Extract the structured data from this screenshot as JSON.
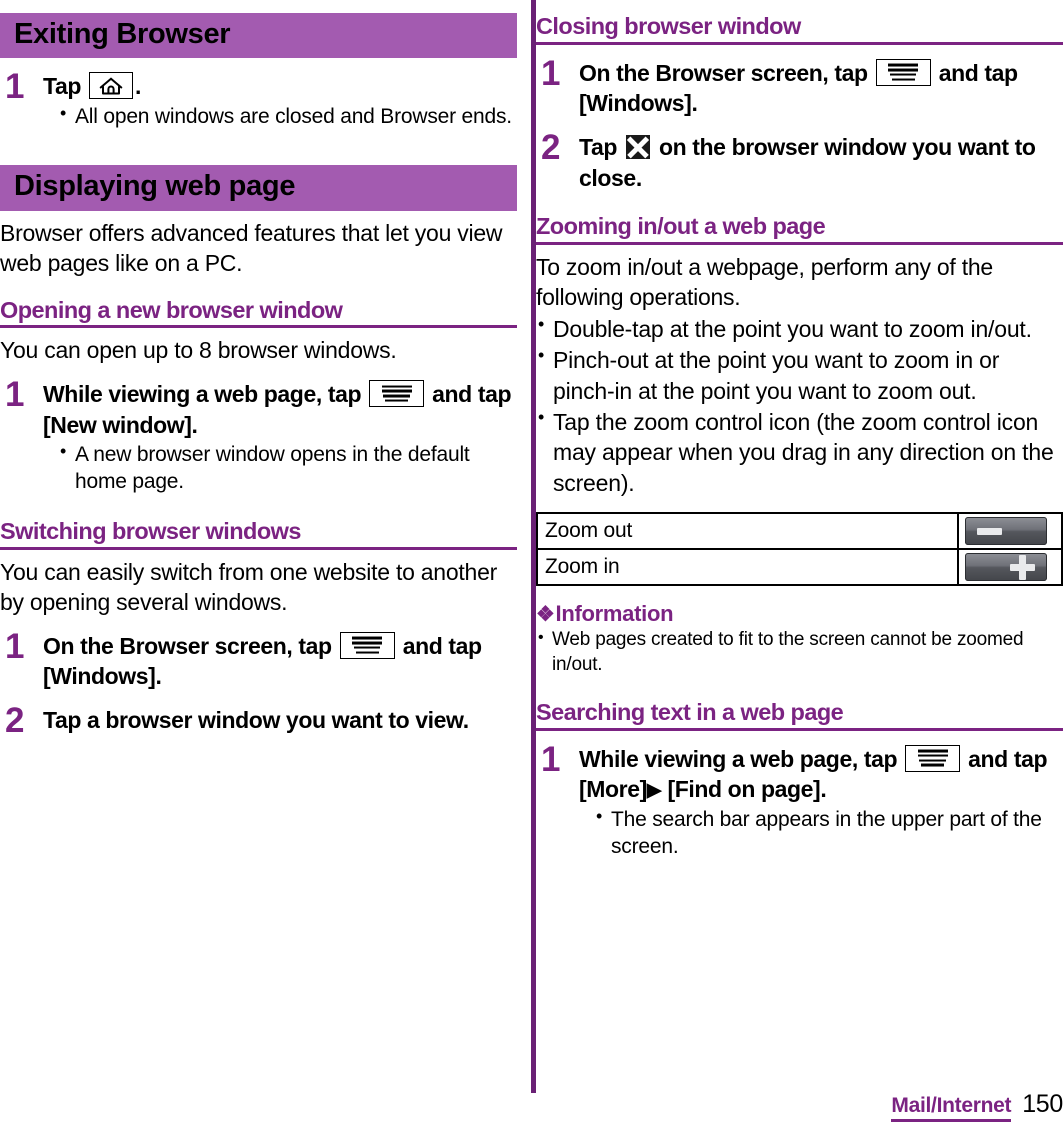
{
  "colors": {
    "banner_bg": "#a35bb0",
    "heading_purple": "#7b2382",
    "divider_purple": "#6a2175",
    "text_black": "#000000"
  },
  "left_column": {
    "banner1": "Exiting Browser",
    "step_exit": {
      "number": "1",
      "title_before": "Tap",
      "title_after": ".",
      "icon": "home-key-icon",
      "bullets": [
        "All open windows are closed and Browser ends."
      ]
    },
    "banner2": "Displaying web page",
    "intro": "Browser offers advanced features that let you view web pages like on a PC.",
    "sub_open": {
      "heading": "Opening a new browser window",
      "paragraph": "You can open up to 8 browser windows.",
      "step": {
        "number": "1",
        "title_before": "While viewing a web page, tap",
        "title_after": "and tap [New window].",
        "icon": "menu-key-icon",
        "bullets": [
          "A new browser window opens in the default home page."
        ]
      }
    },
    "sub_switch": {
      "heading": "Switching browser windows",
      "paragraph": "You can easily switch from one website to another by opening several windows.",
      "steps": [
        {
          "number": "1",
          "title_before": "On the Browser screen, tap",
          "title_after": "and tap [Windows].",
          "icon": "menu-key-icon"
        },
        {
          "number": "2",
          "title": "Tap a browser window you want to view."
        }
      ]
    }
  },
  "right_column": {
    "sub_close": {
      "heading": "Closing browser window",
      "steps": [
        {
          "number": "1",
          "title_before": "On the Browser screen, tap",
          "title_after": "and tap [Windows].",
          "icon": "menu-key-icon"
        },
        {
          "number": "2",
          "title_before": "Tap",
          "title_after": "on the browser window you want to close.",
          "icon": "close-window-icon"
        }
      ]
    },
    "sub_zoom": {
      "heading": "Zooming in/out a web page",
      "paragraph": "To zoom in/out a webpage, perform any of the following operations.",
      "bullets": [
        "Double-tap at the point you want to zoom in/out.",
        "Pinch-out at the point you want to zoom in or pinch-in at the point you want to zoom out.",
        "Tap the zoom control icon (the zoom control icon may appear when you drag in any direction on the screen)."
      ],
      "table": {
        "rows": [
          {
            "label": "Zoom out",
            "icon": "zoom-out-button-icon"
          },
          {
            "label": "Zoom in",
            "icon": "zoom-in-button-icon"
          }
        ]
      },
      "information": {
        "marker": "❖",
        "heading": "Information",
        "bullets": [
          "Web pages created to fit to the screen cannot be zoomed in/out."
        ]
      }
    },
    "sub_search": {
      "heading": "Searching text in a web page",
      "step": {
        "number": "1",
        "title_before": "While viewing a web page, tap",
        "title_mid": "and tap [More]",
        "title_arrow": "▶",
        "title_after": "[Find on page].",
        "icon": "menu-key-icon",
        "bullets": [
          "The search bar appears in the upper part of the screen."
        ]
      }
    }
  },
  "footer": {
    "chapter": "Mail/Internet",
    "page_number": "150"
  }
}
